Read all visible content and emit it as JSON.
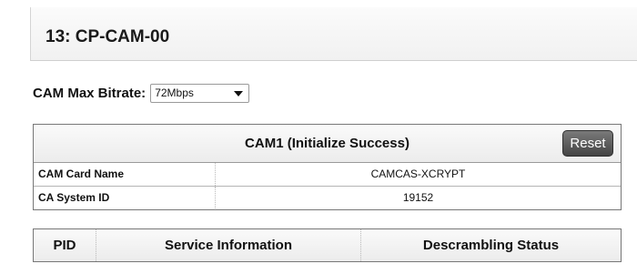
{
  "page": {
    "title": "13: CP-CAM-00"
  },
  "bitrate": {
    "label": "CAM Max Bitrate:",
    "selected": "72Mbps"
  },
  "cam": {
    "header": "CAM1 (Initialize Success)",
    "reset_label": "Reset",
    "rows": [
      {
        "key": "CAM Card Name",
        "value": "CAMCAS-XCRYPT"
      },
      {
        "key": "CA System ID",
        "value": "19152"
      }
    ]
  },
  "pid_table": {
    "columns": [
      "PID",
      "Service Information",
      "Descrambling Status"
    ]
  }
}
